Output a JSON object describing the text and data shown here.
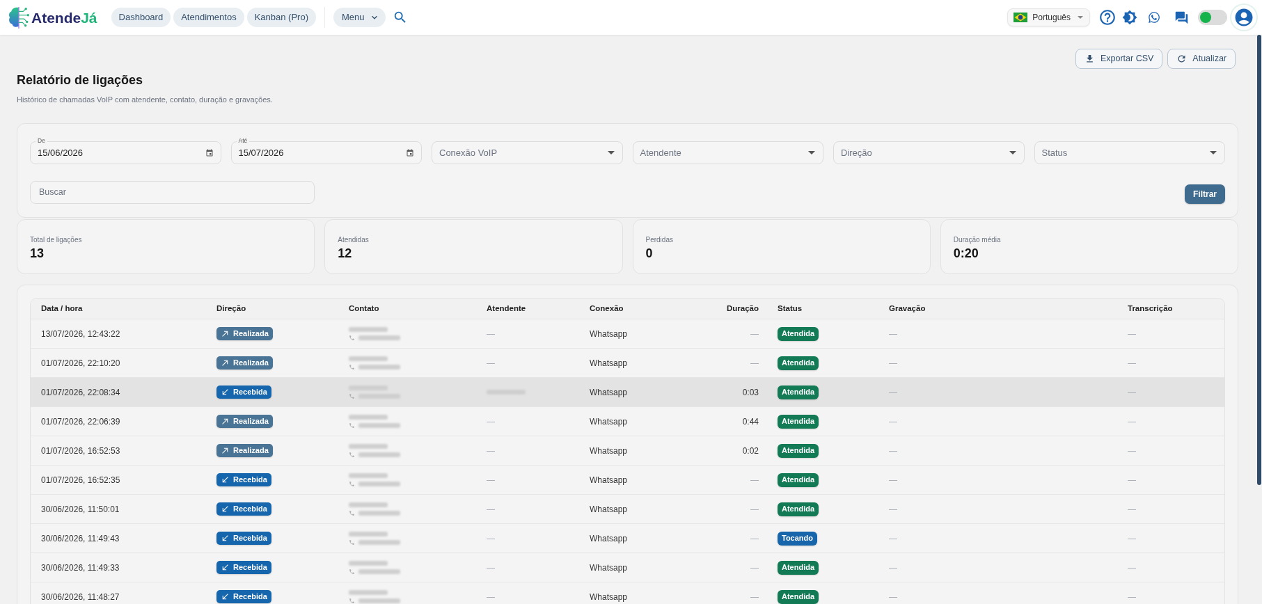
{
  "topbar": {
    "logo": {
      "text": "Atende",
      "accent": "Já"
    },
    "nav": [
      {
        "label": "Dashboard",
        "kind": "link"
      },
      {
        "label": "Atendimentos",
        "kind": "link"
      },
      {
        "label": "Kanban (Pro)",
        "kind": "link"
      },
      {
        "label": "Menu",
        "kind": "dropdown"
      }
    ],
    "language": {
      "label": "Português"
    },
    "toggle": {
      "on": true
    }
  },
  "page": {
    "actions": [
      {
        "label": "Exportar CSV",
        "kind": "download"
      },
      {
        "label": "Atualizar",
        "kind": "refresh"
      }
    ],
    "title": "Relatório de ligações",
    "subtitle": "Histórico de chamadas VoIP com atendente, contato, duração e gravações."
  },
  "filters": {
    "fields": [
      {
        "kind": "date",
        "label": "De",
        "value": "15/06/2026"
      },
      {
        "kind": "date",
        "label": "Até",
        "value": "15/07/2026"
      },
      {
        "kind": "select",
        "placeholder": "Conexão VoIP"
      },
      {
        "kind": "select",
        "placeholder": "Atendente"
      },
      {
        "kind": "select",
        "placeholder": "Direção"
      },
      {
        "kind": "select",
        "placeholder": "Status"
      }
    ],
    "search": {
      "placeholder": "Buscar"
    },
    "submit": "Filtrar"
  },
  "stats": [
    {
      "label": "Total de ligações",
      "value": "13"
    },
    {
      "label": "Atendidas",
      "value": "12"
    },
    {
      "label": "Perdidas",
      "value": "0"
    },
    {
      "label": "Duração média",
      "value": "0:20"
    }
  ],
  "table": {
    "columns": [
      "Data / hora",
      "Direção",
      "Contato",
      "Atendente",
      "Conexão",
      "Duração",
      "Status",
      "Gravação",
      "Transcrição"
    ],
    "rows": [
      {
        "datetime": "13/07/2026, 12:43:22",
        "direction": {
          "kind": "outgoing",
          "label": "Realizada"
        },
        "contact": {
          "kind": "redacted"
        },
        "agent": {
          "kind": "empty",
          "text": "—"
        },
        "connection": "Whatsapp",
        "duration": {
          "kind": "empty",
          "text": "—"
        },
        "status": {
          "kind": "answered",
          "label": "Atendida"
        },
        "recording": "—",
        "transcription": "—",
        "highlighted": false
      },
      {
        "datetime": "01/07/2026, 22:10:20",
        "direction": {
          "kind": "outgoing",
          "label": "Realizada"
        },
        "contact": {
          "kind": "redacted"
        },
        "agent": {
          "kind": "empty",
          "text": "—"
        },
        "connection": "Whatsapp",
        "duration": {
          "kind": "empty",
          "text": "—"
        },
        "status": {
          "kind": "answered",
          "label": "Atendida"
        },
        "recording": "—",
        "transcription": "—",
        "highlighted": false
      },
      {
        "datetime": "01/07/2026, 22:08:34",
        "direction": {
          "kind": "incoming",
          "label": "Recebida"
        },
        "contact": {
          "kind": "redacted"
        },
        "agent": {
          "kind": "redacted"
        },
        "connection": "Whatsapp",
        "duration": {
          "kind": "value",
          "text": "0:03"
        },
        "status": {
          "kind": "answered",
          "label": "Atendida"
        },
        "recording": "—",
        "transcription": "—",
        "highlighted": true
      },
      {
        "datetime": "01/07/2026, 22:06:39",
        "direction": {
          "kind": "outgoing",
          "label": "Realizada"
        },
        "contact": {
          "kind": "redacted"
        },
        "agent": {
          "kind": "empty",
          "text": "—"
        },
        "connection": "Whatsapp",
        "duration": {
          "kind": "value",
          "text": "0:44"
        },
        "status": {
          "kind": "answered",
          "label": "Atendida"
        },
        "recording": "—",
        "transcription": "—",
        "highlighted": false
      },
      {
        "datetime": "01/07/2026, 16:52:53",
        "direction": {
          "kind": "outgoing",
          "label": "Realizada"
        },
        "contact": {
          "kind": "redacted"
        },
        "agent": {
          "kind": "empty",
          "text": "—"
        },
        "connection": "Whatsapp",
        "duration": {
          "kind": "value",
          "text": "0:02"
        },
        "status": {
          "kind": "answered",
          "label": "Atendida"
        },
        "recording": "—",
        "transcription": "—",
        "highlighted": false
      },
      {
        "datetime": "01/07/2026, 16:52:35",
        "direction": {
          "kind": "incoming",
          "label": "Recebida"
        },
        "contact": {
          "kind": "redacted"
        },
        "agent": {
          "kind": "empty",
          "text": "—"
        },
        "connection": "Whatsapp",
        "duration": {
          "kind": "empty",
          "text": "—"
        },
        "status": {
          "kind": "answered",
          "label": "Atendida"
        },
        "recording": "—",
        "transcription": "—",
        "highlighted": false
      },
      {
        "datetime": "30/06/2026, 11:50:01",
        "direction": {
          "kind": "incoming",
          "label": "Recebida"
        },
        "contact": {
          "kind": "redacted"
        },
        "agent": {
          "kind": "empty",
          "text": "—"
        },
        "connection": "Whatsapp",
        "duration": {
          "kind": "empty",
          "text": "—"
        },
        "status": {
          "kind": "answered",
          "label": "Atendida"
        },
        "recording": "—",
        "transcription": "—",
        "highlighted": false
      },
      {
        "datetime": "30/06/2026, 11:49:43",
        "direction": {
          "kind": "incoming",
          "label": "Recebida"
        },
        "contact": {
          "kind": "redacted"
        },
        "agent": {
          "kind": "empty",
          "text": "—"
        },
        "connection": "Whatsapp",
        "duration": {
          "kind": "empty",
          "text": "—"
        },
        "status": {
          "kind": "ringing",
          "label": "Tocando"
        },
        "recording": "—",
        "transcription": "—",
        "highlighted": false
      },
      {
        "datetime": "30/06/2026, 11:49:33",
        "direction": {
          "kind": "incoming",
          "label": "Recebida"
        },
        "contact": {
          "kind": "redacted"
        },
        "agent": {
          "kind": "empty",
          "text": "—"
        },
        "connection": "Whatsapp",
        "duration": {
          "kind": "empty",
          "text": "—"
        },
        "status": {
          "kind": "answered",
          "label": "Atendida"
        },
        "recording": "—",
        "transcription": "—",
        "highlighted": false
      },
      {
        "datetime": "30/06/2026, 11:48:27",
        "direction": {
          "kind": "incoming",
          "label": "Recebida"
        },
        "contact": {
          "kind": "redacted"
        },
        "agent": {
          "kind": "empty",
          "text": "—"
        },
        "connection": "Whatsapp",
        "duration": {
          "kind": "empty",
          "text": "—"
        },
        "status": {
          "kind": "answered",
          "label": "Atendida"
        },
        "recording": "—",
        "transcription": "—",
        "highlighted": false
      }
    ]
  }
}
